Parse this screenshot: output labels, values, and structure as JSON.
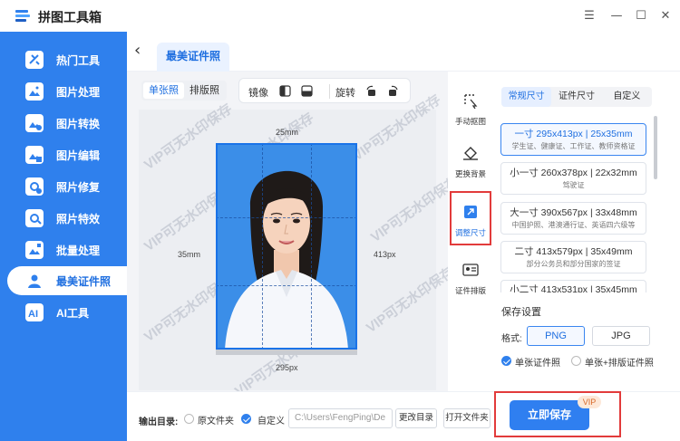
{
  "app": {
    "title": "拼图工具箱"
  },
  "sidebar": {
    "items": [
      {
        "label": "热门工具",
        "icon": "hot-tools-icon"
      },
      {
        "label": "图片处理",
        "icon": "image-process-icon"
      },
      {
        "label": "图片转换",
        "icon": "image-convert-icon"
      },
      {
        "label": "图片编辑",
        "icon": "image-edit-icon"
      },
      {
        "label": "照片修复",
        "icon": "photo-repair-icon"
      },
      {
        "label": "照片特效",
        "icon": "photo-effect-icon"
      },
      {
        "label": "批量处理",
        "icon": "batch-icon"
      },
      {
        "label": "最美证件照",
        "icon": "id-photo-icon",
        "active": true
      },
      {
        "label": "AI工具",
        "icon": "ai-icon"
      }
    ]
  },
  "breadcrumb": {
    "tab": "最美证件照"
  },
  "mode_tabs": [
    "单张照",
    "排版照"
  ],
  "toolbar": {
    "mirror": "镜像",
    "rotate": "旋转"
  },
  "canvas": {
    "dim_top": "25mm",
    "dim_left": "35mm",
    "dim_right": "413px",
    "dim_bottom": "295px",
    "watermark": "VIP可无水印保存"
  },
  "tools": [
    {
      "label": "手动抠图",
      "icon": "manual-cutout-icon"
    },
    {
      "label": "更换背景",
      "icon": "change-background-icon"
    },
    {
      "label": "调整尺寸",
      "icon": "resize-icon",
      "active": true
    },
    {
      "label": "证件排版",
      "icon": "layout-icon"
    }
  ],
  "size_tabs": [
    "常规尺寸",
    "证件尺寸",
    "自定义"
  ],
  "sizes": [
    {
      "main": "一寸 295x413px | 25x35mm",
      "sub": "学生证、健康证、工作证、教师资格证",
      "active": true
    },
    {
      "main": "小一寸 260x378px | 22x32mm",
      "sub": "驾驶证"
    },
    {
      "main": "大一寸 390x567px | 33x48mm",
      "sub": "中国护照、港澳通行证、英语四六级等"
    },
    {
      "main": "二寸 413x579px | 35x49mm",
      "sub": "部分公务员和部分国家的签证"
    },
    {
      "main": "小二寸 413x531px | 35x45mm",
      "sub": ""
    }
  ],
  "save_settings": {
    "title": "保存设置",
    "format_label": "格式:",
    "formats": [
      "PNG",
      "JPG"
    ],
    "options": [
      "单张证件照",
      "单张+排版证件照"
    ]
  },
  "bottom": {
    "output_label": "输出目录:",
    "radio_original": "原文件夹",
    "radio_custom": "自定义",
    "path": "C:\\Users\\FengPing\\De",
    "change_dir": "更改目录",
    "open_folder": "打开文件夹",
    "save_button": "立即保存",
    "vip": "VIP"
  },
  "colors": {
    "accent": "#2f80ed",
    "photo_bg": "#3b8ee8",
    "highlight": "#e23b3b"
  }
}
